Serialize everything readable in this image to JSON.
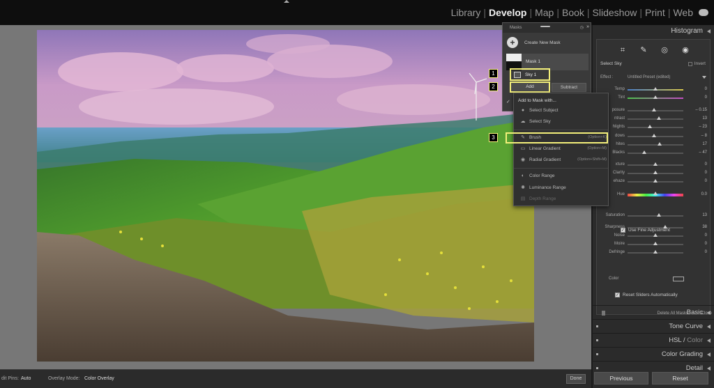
{
  "topbar": {
    "modules": [
      "Library",
      "Develop",
      "Map",
      "Book",
      "Slideshow",
      "Print",
      "Web"
    ],
    "active_module": "Develop"
  },
  "bottombar": {
    "edit_pins_label": "dit Pins:",
    "edit_pins_value": "Auto",
    "overlay_mode_label": "Overlay Mode:",
    "overlay_mode_value": "Color Overlay",
    "done_label": "Done"
  },
  "masks_panel": {
    "title": "Masks",
    "create_new": "Create New Mask",
    "mask1": "Mask 1",
    "sky1": "Sky 1",
    "add": "Add",
    "subtract": "Subtract"
  },
  "add_menu": {
    "header": "Add to Mask with...",
    "items": [
      {
        "label": "Select Subject",
        "shortcut": "",
        "icon": "person-icon",
        "disabled": false
      },
      {
        "label": "Select Sky",
        "shortcut": "",
        "icon": "sky-icon",
        "disabled": false
      },
      {
        "label": "Brush",
        "shortcut": "(Option+K)",
        "icon": "brush-icon",
        "disabled": false
      },
      {
        "label": "Linear Gradient",
        "shortcut": "(Option+M)",
        "icon": "linear-gradient-icon",
        "disabled": false
      },
      {
        "label": "Radial Gradient",
        "shortcut": "(Option+Shift+M)",
        "icon": "radial-gradient-icon",
        "disabled": false
      },
      {
        "label": "Color Range",
        "shortcut": "",
        "icon": "color-range-icon",
        "disabled": false
      },
      {
        "label": "Luminance Range",
        "shortcut": "",
        "icon": "luminance-range-icon",
        "disabled": false
      },
      {
        "label": "Depth Range",
        "shortcut": "",
        "icon": "depth-range-icon",
        "disabled": true
      }
    ]
  },
  "badges": [
    "1",
    "2",
    "3"
  ],
  "right_panel": {
    "histogram": "Histogram",
    "mask_name": "Select Sky",
    "invert": "Invert",
    "effect_label": "Effect :",
    "effect_value": "Untitled Preset (edited)",
    "sliders": [
      {
        "label": "Temp",
        "value": "0",
        "pos": 0.5
      },
      {
        "label": "Tint",
        "value": "0",
        "pos": 0.5
      },
      {
        "label": "posure",
        "value": "– 0.15",
        "pos": 0.48
      },
      {
        "label": "ntrast",
        "value": "13",
        "pos": 0.56
      },
      {
        "label": "hlights",
        "value": "– 23",
        "pos": 0.4
      },
      {
        "label": "dows",
        "value": "– 8",
        "pos": 0.47
      },
      {
        "label": "hites",
        "value": "17",
        "pos": 0.57
      },
      {
        "label": "Blacks",
        "value": "– 47",
        "pos": 0.3
      },
      {
        "label": "xture",
        "value": "0",
        "pos": 0.5
      },
      {
        "label": "Clarity",
        "value": "0",
        "pos": 0.5
      },
      {
        "label": "ehaze",
        "value": "0",
        "pos": 0.5
      },
      {
        "label": "Hue",
        "value": "0.0",
        "pos": 0.5
      },
      {
        "label": "Saturation",
        "value": "13",
        "pos": 0.56
      },
      {
        "label": "Sharpness",
        "value": "38",
        "pos": 0.68
      },
      {
        "label": "Noise",
        "value": "0",
        "pos": 0.5
      },
      {
        "label": "Moire",
        "value": "0",
        "pos": 0.5
      },
      {
        "label": "Defringe",
        "value": "0",
        "pos": 0.5
      }
    ],
    "fine_adjustment": "Use Fine Adjustment",
    "color_label": "Color",
    "reset_sliders": "Reset Sliders Automatically",
    "delete_all": "Delete All Masks",
    "close": "Close",
    "sections": [
      "Basic",
      "Tone Curve",
      "HSL",
      "Color",
      "Color Grading",
      "Detail"
    ],
    "previous": "Previous",
    "reset": "Reset"
  },
  "colors": {
    "highlight": "#f4f07a",
    "sky_overlay": "#c79ac8"
  }
}
